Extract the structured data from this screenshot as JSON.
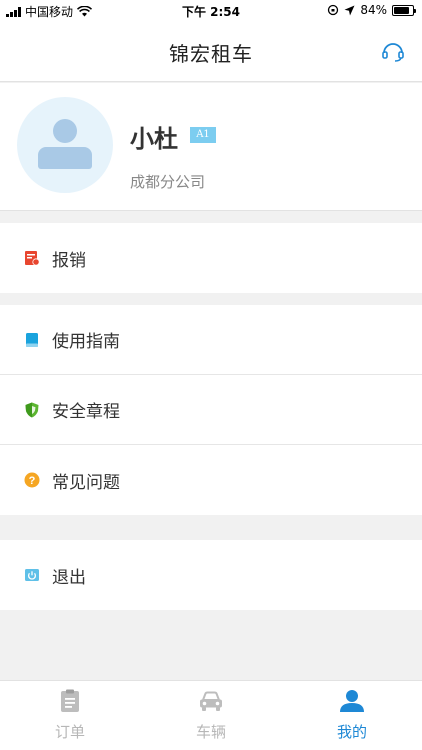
{
  "status_bar": {
    "carrier": "中国移动",
    "time": "下午 2:54",
    "battery_percent": "84%",
    "battery_level": 0.84
  },
  "navbar": {
    "title": "锦宏租车",
    "service_icon": "headset-icon"
  },
  "profile": {
    "name": "小杜",
    "level": "A1",
    "company": "成都分公司",
    "avatar_icon": "user-avatar-icon"
  },
  "menu": {
    "reimbursement": "报销",
    "user_guide": "使用指南",
    "safety_rules": "安全章程",
    "faq": "常见问题",
    "logout": "退出"
  },
  "tabs": [
    {
      "label": "订单",
      "icon": "clipboard-icon"
    },
    {
      "label": "车辆",
      "icon": "car-icon"
    },
    {
      "label": "我的",
      "icon": "person-icon"
    }
  ],
  "colors": {
    "accent": "#1e88d5",
    "reimburse_icon": "#e8462f",
    "guide_icon": "#1aa3dd",
    "safety_icon": "#5cb531",
    "faq_icon": "#f5a623",
    "logout_icon": "#5fc0e8"
  }
}
